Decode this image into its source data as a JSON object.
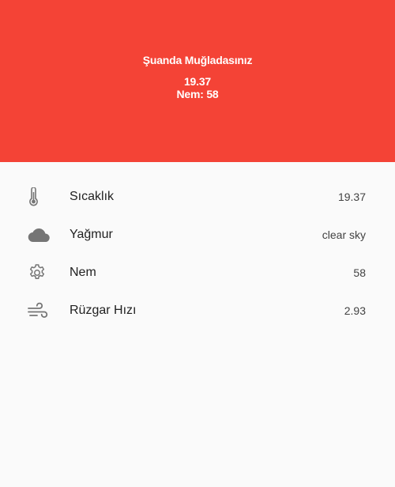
{
  "header": {
    "location": "Şuanda Muğladasınız",
    "temperature": "19.37",
    "humidity": "Nem: 58",
    "color": "#f44336"
  },
  "rows": [
    {
      "icon": "thermometer-icon",
      "label": "Sıcaklık",
      "value": "19.37"
    },
    {
      "icon": "cloud-icon",
      "label": "Yağmur",
      "value": "clear sky"
    },
    {
      "icon": "gear-icon",
      "label": "Nem",
      "value": "58"
    },
    {
      "icon": "wind-icon",
      "label": "Rüzgar Hızı",
      "value": "2.93"
    }
  ]
}
